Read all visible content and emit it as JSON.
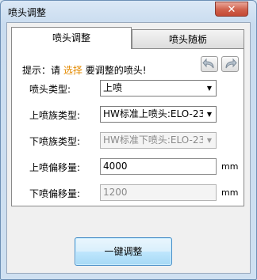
{
  "window": {
    "title": "喷头调整",
    "close_label": "✕"
  },
  "tabs": [
    {
      "label": "喷头调整",
      "active": true
    },
    {
      "label": "喷头随栃",
      "active": false
    }
  ],
  "hint": {
    "prefix": "提示：请",
    "highlight": "选择",
    "suffix": "要调整的喷头!",
    "highlight_color": "#e38a00"
  },
  "toolbar": {
    "undo_icon": "undo-arrow",
    "redo_icon": "redo-arrow"
  },
  "form": {
    "nozzle_type": {
      "label": "喷头类型:",
      "value": "上喷"
    },
    "upper_family": {
      "label": "上喷族类型:",
      "value": "HW标准上喷头:ELO-23"
    },
    "lower_family": {
      "label": "下喷族类型:",
      "value": "HW标准下喷头:ELO-23",
      "disabled": true
    },
    "upper_offset": {
      "label": "上喷偏移量:",
      "value": "4000",
      "unit": "mm"
    },
    "lower_offset": {
      "label": "下喷偏移量:",
      "value": "1200",
      "unit": "mm",
      "disabled": true
    }
  },
  "actions": {
    "adjust_label": "一键调整"
  }
}
